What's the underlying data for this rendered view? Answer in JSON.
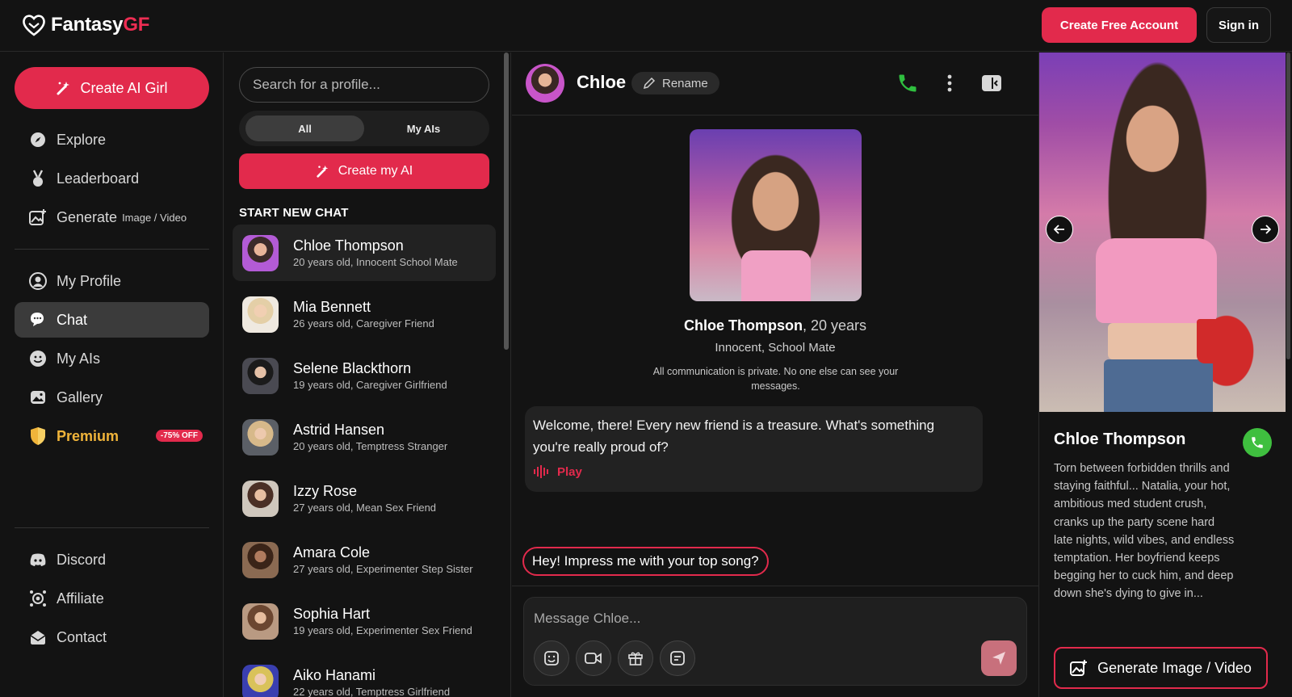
{
  "brand": {
    "name_part1": "Fantasy",
    "name_part2": "GF"
  },
  "header": {
    "create_account_label": "Create Free Account",
    "signin_label": "Sign in"
  },
  "leftnav": {
    "create_label": "Create AI Girl",
    "items": [
      {
        "label": "Explore",
        "icon": "compass-icon"
      },
      {
        "label": "Leaderboard",
        "icon": "medal-icon"
      },
      {
        "label": "Generate",
        "sub": "Image / Video",
        "icon": "image-plus-icon"
      },
      {
        "label": "My Profile",
        "icon": "user-icon"
      },
      {
        "label": "Chat",
        "icon": "chat-bubbles-icon",
        "active": true
      },
      {
        "label": "My AIs",
        "icon": "smiley-icon"
      },
      {
        "label": "Gallery",
        "icon": "gallery-icon"
      },
      {
        "label": "Premium",
        "badge": "-75% OFF",
        "icon": "shield-icon"
      },
      {
        "label": "Discord",
        "icon": "discord-icon"
      },
      {
        "label": "Affiliate",
        "icon": "affiliate-icon"
      },
      {
        "label": "Contact",
        "icon": "mail-icon"
      }
    ]
  },
  "chatlist": {
    "search_placeholder": "Search for a profile...",
    "tabs": [
      {
        "label": "All",
        "active": true
      },
      {
        "label": "My AIs"
      }
    ],
    "create_label": "Create my AI",
    "section_title": "START NEW CHAT",
    "profiles": [
      {
        "name": "Chloe Thompson",
        "desc": "20 years old, Innocent School Mate",
        "active": true
      },
      {
        "name": "Mia Bennett",
        "desc": "26 years old, Caregiver Friend"
      },
      {
        "name": "Selene Blackthorn",
        "desc": "19 years old, Caregiver Girlfriend"
      },
      {
        "name": "Astrid Hansen",
        "desc": "20 years old, Temptress Stranger"
      },
      {
        "name": "Izzy Rose",
        "desc": "27 years old, Mean Sex Friend"
      },
      {
        "name": "Amara Cole",
        "desc": "27 years old, Experimenter Step Sister"
      },
      {
        "name": "Sophia Hart",
        "desc": "19 years old, Experimenter Sex Friend"
      },
      {
        "name": "Aiko Hanami",
        "desc": "22 years old, Temptress Girlfriend"
      }
    ]
  },
  "chat": {
    "name": "Chloe",
    "rename_label": "Rename",
    "intro_name": "Chloe Thompson",
    "intro_age": ", 20 years",
    "intro_role": "Innocent, School Mate",
    "privacy": "All communication is private. No one else can see your messages.",
    "message": "Welcome, there! Every new friend is a treasure. What's something you're really proud of?",
    "play_label": "Play",
    "suggestion": "Hey! Impress me with your top song?",
    "input_placeholder": "Message Chloe..."
  },
  "profile_panel": {
    "name": "Chloe Thompson",
    "description": "Torn between forbidden thrills and staying faithful... Natalia, your hot, ambitious med student crush, cranks up the party scene hard late nights, wild vibes, and endless temptation. Her boyfriend keeps begging her to cuck him, and deep down she's dying to give in...",
    "generate_label": "Generate Image / Video"
  },
  "colors": {
    "accent": "#e22a4c",
    "premium": "#f0b43a",
    "call_green": "#3fbf3f"
  }
}
